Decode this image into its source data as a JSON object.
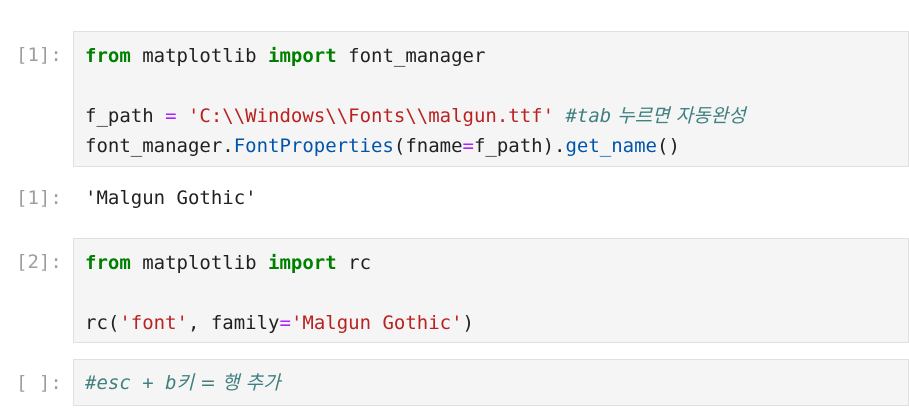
{
  "cells": [
    {
      "prompt": "[1]:",
      "line1": {
        "kw_from": "from",
        "mod": " matplotlib ",
        "kw_import": "import",
        "name": " font_manager"
      },
      "line2": {
        "var": "f_path ",
        "eq": "=",
        "sp": " ",
        "str": "'C:\\\\Windows\\\\Fonts\\\\malgun.ttf'",
        "sp2": " ",
        "comment": "#tab",
        "comment_kr": " 누르면 자동완성"
      },
      "line3": {
        "obj": "font_manager.",
        "fn1": "FontProperties",
        "open": "(fname",
        "eq": "=",
        "arg": "f_path).",
        "fn2": "get_name",
        "close": "()"
      },
      "output_prompt": "[1]:",
      "output": "'Malgun Gothic'"
    },
    {
      "prompt": "[2]:",
      "line1": {
        "kw_from": "from",
        "mod": " matplotlib ",
        "kw_import": "import",
        "name": " rc"
      },
      "line2": {
        "call": "rc(",
        "str1": "'font'",
        "mid": ", family",
        "eq": "=",
        "str2": "'Malgun Gothic'",
        "close": ")"
      }
    },
    {
      "prompt": "[ ]:",
      "line1": {
        "comment": "#esc + b",
        "comment_kr": "키 = 행 추가"
      }
    }
  ]
}
